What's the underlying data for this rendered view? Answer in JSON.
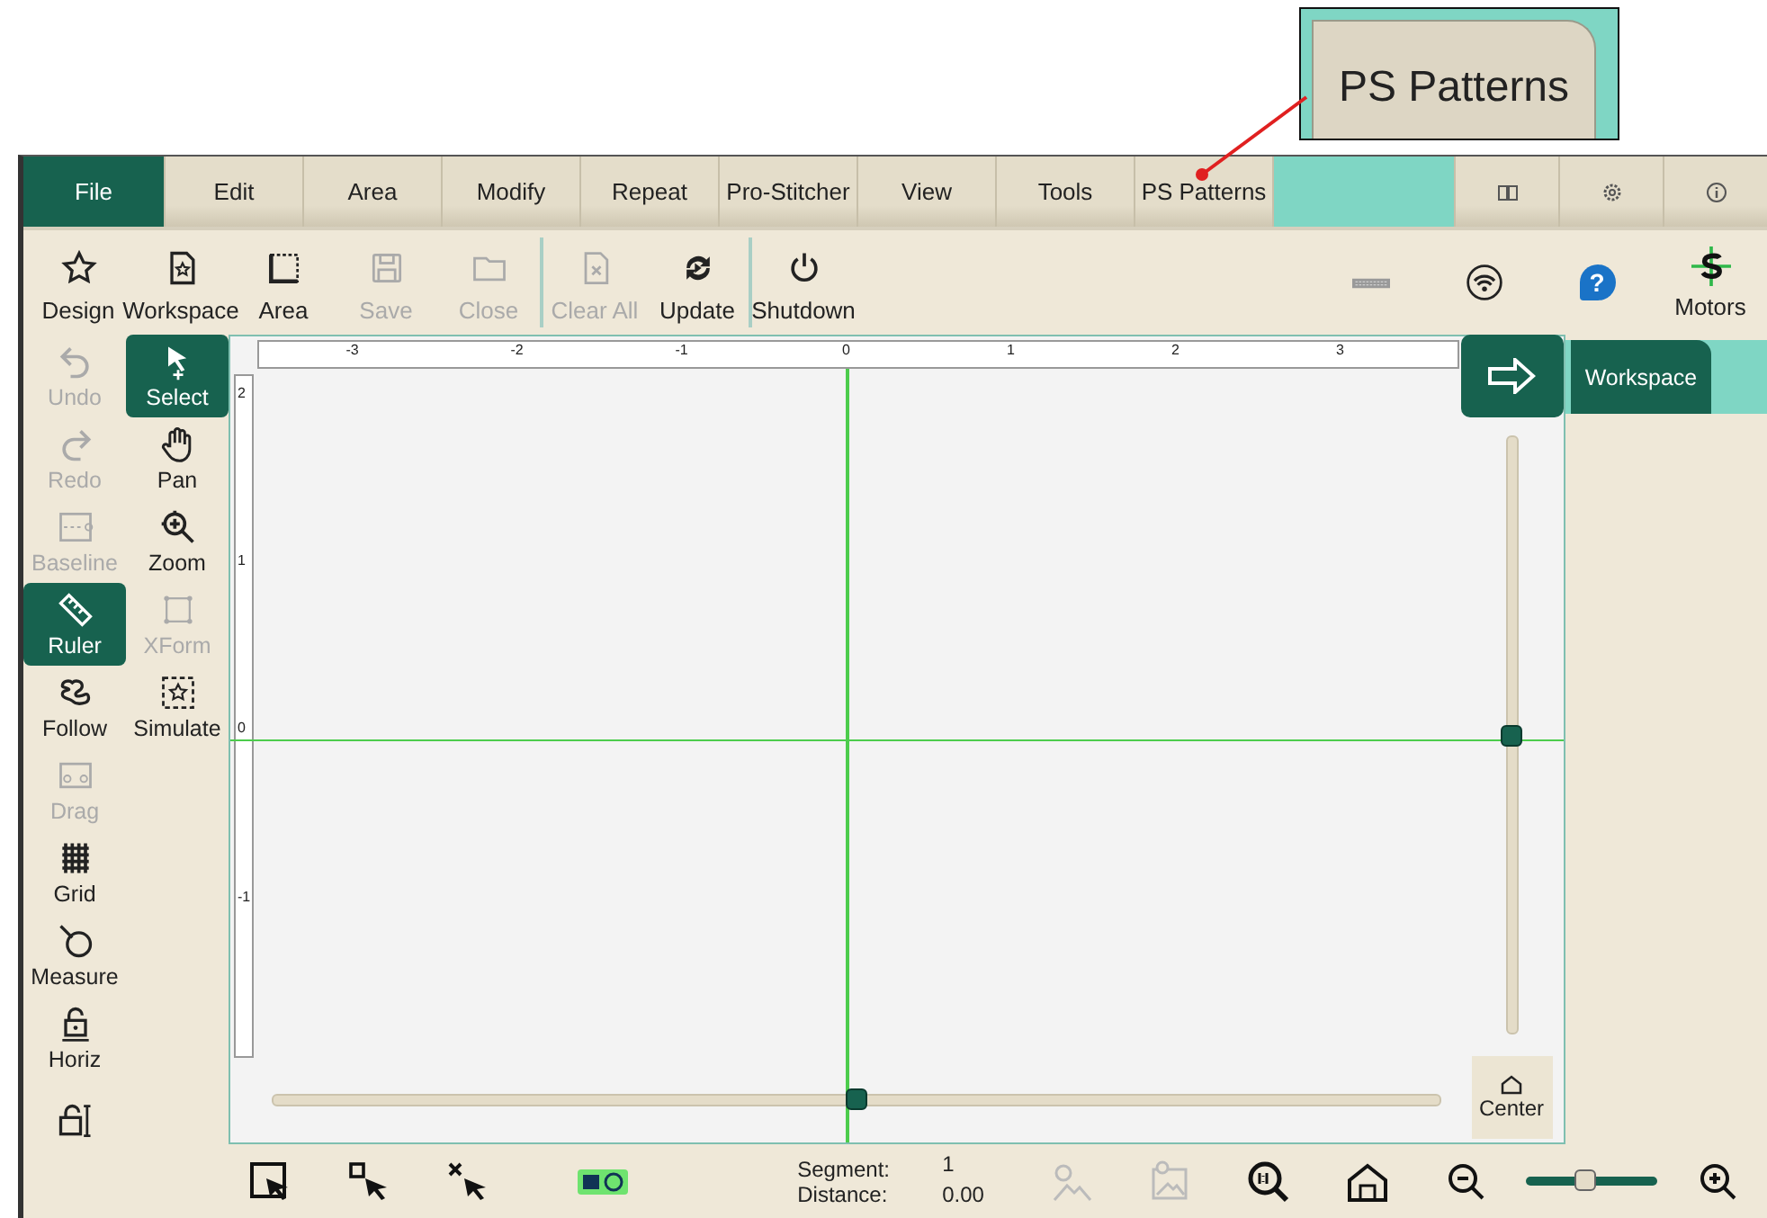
{
  "callout": {
    "label": "PS Patterns"
  },
  "menu_tabs": [
    {
      "label": "File",
      "selected": true
    },
    {
      "label": "Edit",
      "selected": false
    },
    {
      "label": "Area",
      "selected": false
    },
    {
      "label": "Modify",
      "selected": false
    },
    {
      "label": "Repeat",
      "selected": false
    },
    {
      "label": "Pro-Stitcher",
      "selected": false
    },
    {
      "label": "View",
      "selected": false
    },
    {
      "label": "Tools",
      "selected": false
    },
    {
      "label": "PS Patterns",
      "selected": false
    }
  ],
  "toolbar": {
    "items": [
      {
        "label": "Design",
        "disabled": false
      },
      {
        "label": "Workspace",
        "disabled": false
      },
      {
        "label": "Area",
        "disabled": false
      },
      {
        "label": "Save",
        "disabled": true
      },
      {
        "label": "Close",
        "disabled": true
      },
      {
        "label": "Clear All",
        "disabled": true
      },
      {
        "label": "Update",
        "disabled": false
      },
      {
        "label": "Shutdown",
        "disabled": false
      }
    ],
    "help_label": "?",
    "motors_label": "Motors"
  },
  "tools": {
    "left": [
      {
        "label": "Undo",
        "disabled": true,
        "selected": false
      },
      {
        "label": "Redo",
        "disabled": true,
        "selected": false
      },
      {
        "label": "Baseline",
        "disabled": true,
        "selected": false
      },
      {
        "label": "Ruler",
        "disabled": false,
        "selected": true
      },
      {
        "label": "Follow",
        "disabled": false,
        "selected": false
      },
      {
        "label": "Drag",
        "disabled": true,
        "selected": false
      },
      {
        "label": "Grid",
        "disabled": false,
        "selected": false
      },
      {
        "label": "Measure",
        "disabled": false,
        "selected": false
      },
      {
        "label": "Horiz",
        "disabled": false,
        "selected": false
      }
    ],
    "right": [
      {
        "label": "Select",
        "disabled": false,
        "selected": true
      },
      {
        "label": "Pan",
        "disabled": false,
        "selected": false
      },
      {
        "label": "Zoom",
        "disabled": false,
        "selected": false
      },
      {
        "label": "XForm",
        "disabled": true,
        "selected": false
      },
      {
        "label": "Simulate",
        "disabled": false,
        "selected": false
      }
    ]
  },
  "canvas": {
    "x_ruler": [
      "-3",
      "-2",
      "-1",
      "0",
      "1",
      "2",
      "3"
    ],
    "y_ruler": [
      "2",
      "1",
      "0",
      "-1"
    ],
    "vertical_slider": {
      "level": 0.5
    },
    "horizontal_slider": {
      "level": 0.5
    },
    "center_button": "Center"
  },
  "side_panel": {
    "tabs": [
      {
        "label": "Workspace",
        "selected": true
      }
    ]
  },
  "status_bar": {
    "segment_label": "Segment:",
    "segment_value": "1",
    "distance_label": "Distance:",
    "distance_value": "0.00",
    "zoom_slider": {
      "level": 0.45
    }
  }
}
